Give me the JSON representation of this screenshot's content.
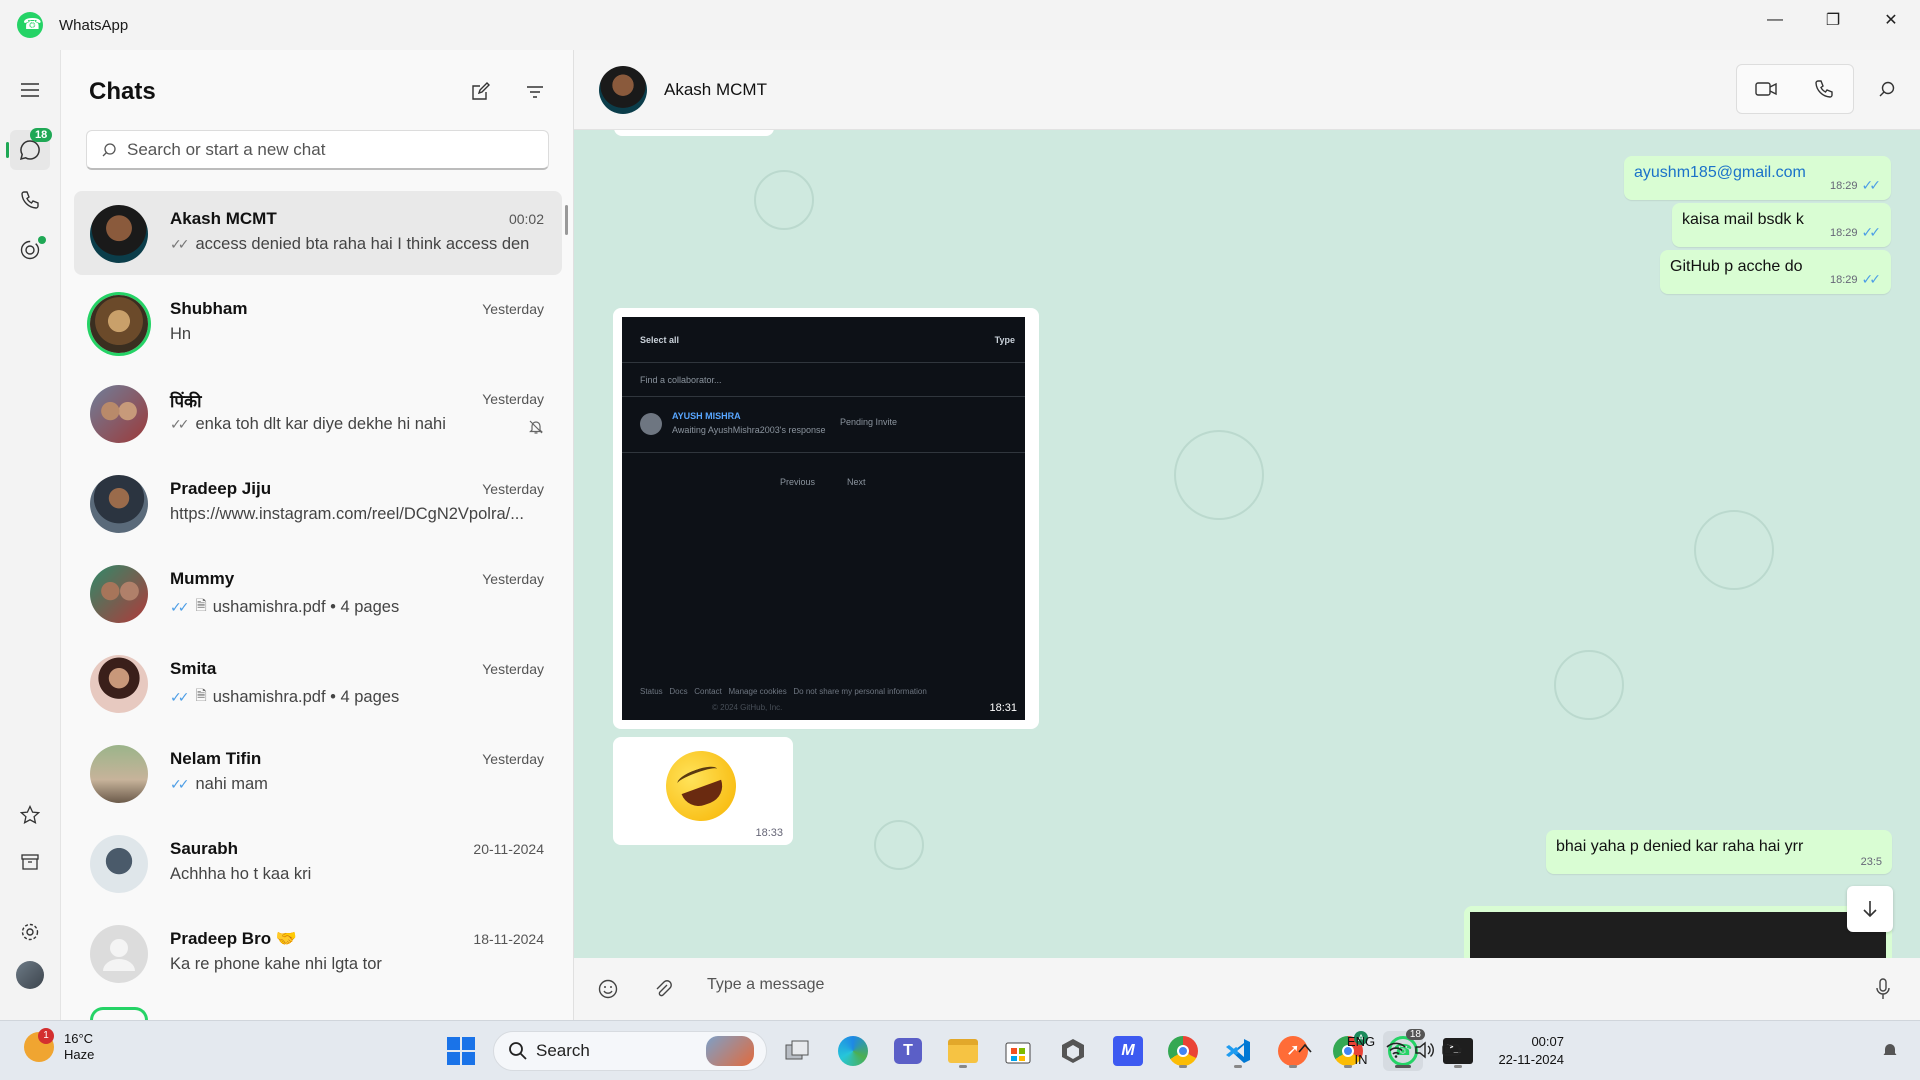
{
  "window": {
    "title": "WhatsApp"
  },
  "rail": {
    "chats_badge": "18"
  },
  "chat_list": {
    "title": "Chats",
    "search_placeholder": "Search or start a new chat",
    "items": [
      {
        "name": "Akash MCMT",
        "time": "00:02",
        "preview": "access denied bta raha hai I think access den...",
        "ticks": "read"
      },
      {
        "name": "Shubham",
        "time": "Yesterday",
        "preview": "Hn"
      },
      {
        "name": "पिंकी",
        "time": "Yesterday",
        "preview": "enka toh dlt kar diye dekhe hi nahi",
        "ticks": "sent",
        "muted": true
      },
      {
        "name": "Pradeep Jiju",
        "time": "Yesterday",
        "preview": "https://www.instagram.com/reel/DCgN2Vpolra/..."
      },
      {
        "name": "Mummy",
        "time": "Yesterday",
        "preview": "ushamishra.pdf • 4 pages",
        "ticks": "read"
      },
      {
        "name": "Smita",
        "time": "Yesterday",
        "preview": "ushamishra.pdf • 4 pages",
        "ticks": "read"
      },
      {
        "name": "Nelam Tifin",
        "time": "Yesterday",
        "preview": "nahi mam",
        "ticks": "read"
      },
      {
        "name": "Saurabh",
        "time": "20-11-2024",
        "preview": "Achhha ho t kaa kri"
      },
      {
        "name": "Pradeep Bro 🤝",
        "time": "18-11-2024",
        "preview": "Ka re phone kahe nhi lgta tor"
      }
    ]
  },
  "conversation": {
    "contact_name": "Akash MCMT",
    "messages": [
      {
        "text": "ayushm185@gmail.com",
        "time": "18:29",
        "dir": "out"
      },
      {
        "text": "kaisa mail bsdk k",
        "time": "18:29",
        "dir": "out"
      },
      {
        "text": "GitHub p acche do",
        "time": "18:29",
        "dir": "out"
      },
      {
        "text": "bhai yaha p denied kar raha hai yrr",
        "time": "23:5",
        "dir": "out"
      }
    ],
    "image_message": {
      "time": "18:31",
      "select_all": "Select all",
      "type_label": "Type",
      "find_placeholder": "Find a collaborator...",
      "collab_name": "AYUSH MISHRA",
      "collab_status": "Awaiting AyushMishra2003's response",
      "pending": "Pending Invite",
      "prev": "Previous",
      "next": "Next",
      "footer": "Status   Docs   Contact   Manage cookies   Do not share my personal information",
      "copyright": "© 2024 GitHub, Inc."
    },
    "sticker_time": "18:33",
    "composer_placeholder": "Type a message"
  },
  "taskbar": {
    "weather_temp": "16°C",
    "weather_desc": "Haze",
    "weather_badge": "1",
    "search_label": "Search",
    "lang_1": "ENG",
    "lang_2": "IN",
    "clock_time": "00:07",
    "clock_date": "22-11-2024",
    "whatsapp_badge": "18"
  }
}
